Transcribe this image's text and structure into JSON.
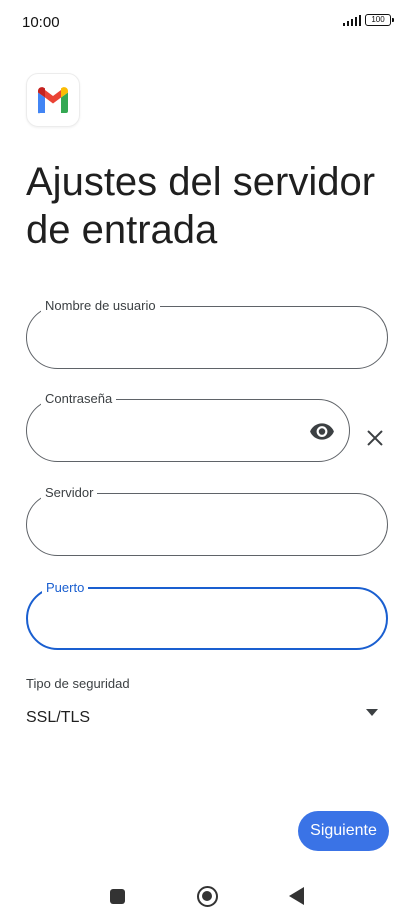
{
  "status_bar": {
    "time": "10:00",
    "battery": "100",
    "signal_icon": "signal-bars-icon",
    "battery_icon": "battery-icon"
  },
  "app": {
    "logo_icon": "gmail-logo-icon"
  },
  "page_title": "Ajustes del servidor de entrada",
  "fields": {
    "username": {
      "label": "Nombre de usuario",
      "value": ""
    },
    "password": {
      "label": "Contraseña",
      "value": "",
      "toggle_icon": "eye-icon",
      "clear_icon": "close-icon"
    },
    "server": {
      "label": "Servidor",
      "value": ""
    },
    "port": {
      "label": "Puerto",
      "value": "",
      "focused": true
    }
  },
  "security": {
    "label": "Tipo de seguridad",
    "selected": "SSL/TLS",
    "dropdown_icon": "dropdown-arrow-icon"
  },
  "next_button": {
    "label": "Siguiente"
  },
  "nav_bar": {
    "recent_icon": "recent-apps-icon",
    "home_icon": "home-icon",
    "back_icon": "back-icon"
  },
  "colors": {
    "accent": "#3a73e6",
    "focus_border": "#1a5fd0",
    "outline": "#5f6368"
  }
}
